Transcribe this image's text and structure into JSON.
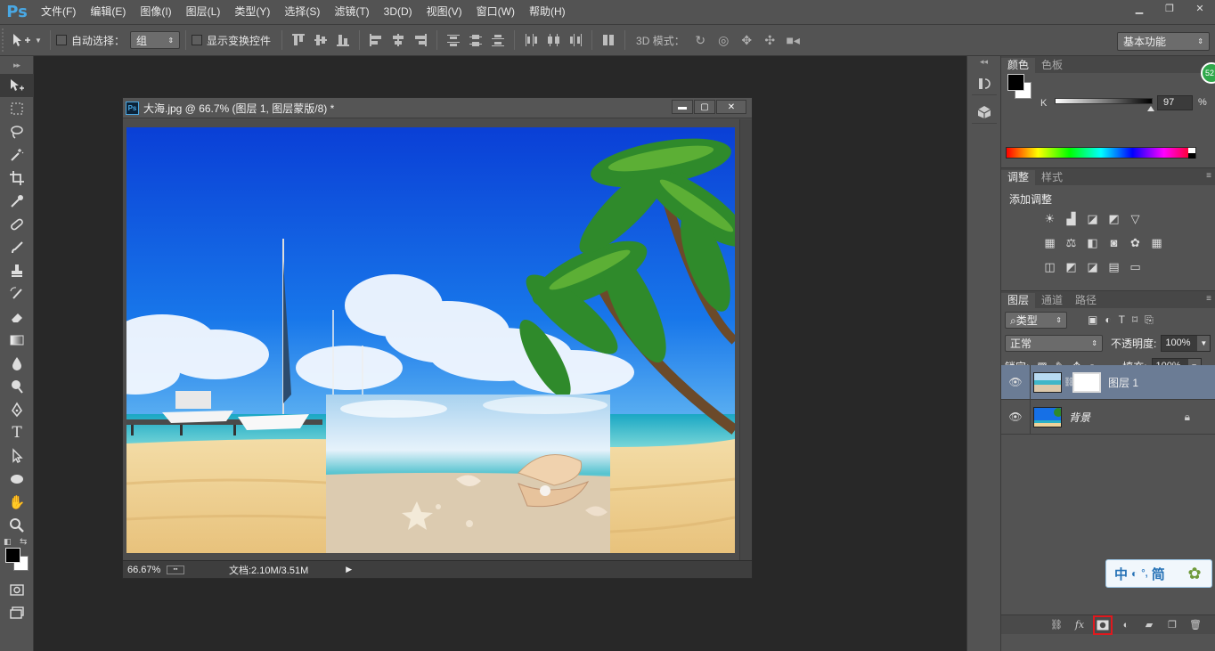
{
  "app": {
    "logo": "Ps"
  },
  "menu": [
    "文件(F)",
    "编辑(E)",
    "图像(I)",
    "图层(L)",
    "类型(Y)",
    "选择(S)",
    "滤镜(T)",
    "3D(D)",
    "视图(V)",
    "窗口(W)",
    "帮助(H)"
  ],
  "options": {
    "auto_select_label": "自动选择：",
    "auto_select_value": "组",
    "show_transform_label": "显示变换控件",
    "mode3d_label": "3D 模式：",
    "workspace": "基本功能"
  },
  "document": {
    "title": "大海.jpg @ 66.7% (图层 1, 图层蒙版/8) *",
    "zoom": "66.67%",
    "doc_size": "文档:2.10M/3.51M"
  },
  "color_panel": {
    "tabs": [
      "颜色",
      "色板"
    ],
    "channel": "K",
    "value": "97",
    "percent": "%",
    "k_level": 0.97,
    "foreground": "#000000",
    "background": "#ffffff"
  },
  "adjust_panel": {
    "tabs": [
      "调整",
      "样式"
    ],
    "title": "添加调整"
  },
  "layers_panel": {
    "tabs": [
      "图层",
      "通道",
      "路径"
    ],
    "filter_type": "类型",
    "blend_mode": "正常",
    "opacity_label": "不透明度:",
    "opacity": "100%",
    "lock_label": "锁定:",
    "fill_label": "填充:",
    "fill": "100%",
    "layers": [
      {
        "name": "图层 1",
        "selected": true
      },
      {
        "name": "背景",
        "selected": false,
        "locked": true
      }
    ]
  },
  "overlay": {
    "badge": "52",
    "ime_zh": "中",
    "ime_simplified": "简"
  }
}
